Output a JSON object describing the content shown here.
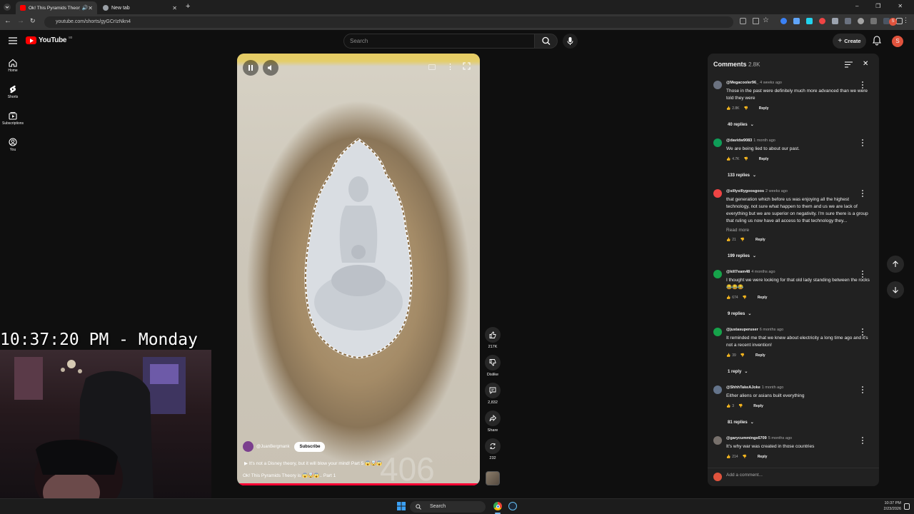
{
  "browser": {
    "tabs": [
      {
        "label": "Ok! This Pyramids Theory is",
        "active": true
      },
      {
        "label": "New tab",
        "active": false
      }
    ],
    "url": "youtube.com/shorts/gyGCrIzNkn4"
  },
  "header": {
    "logo_text": "YouTube",
    "logo_badge": "80",
    "search_placeholder": "Search",
    "create_label": "Create",
    "avatar_letter": "S"
  },
  "sidebar": {
    "items": [
      {
        "label": "Home",
        "icon": "home-icon"
      },
      {
        "label": "Shorts",
        "icon": "shorts-icon"
      },
      {
        "label": "Subscriptions",
        "icon": "subscriptions-icon"
      },
      {
        "label": "You",
        "icon": "you-icon"
      }
    ]
  },
  "video": {
    "channel": "@JuanBergmank",
    "subscribe_label": "Subscribe",
    "description": "It's not a Disney theory, but it will blow your mind! Part 5 😱🤯😱",
    "title": "Ok! This Pyramids Theory is 😱🤯😱.. Part 1",
    "progress": 1.0,
    "background_text": "406"
  },
  "actions": {
    "likes": "217K",
    "dislike_label": "Dislike",
    "comments": "2,832",
    "share_label": "Share",
    "remix": "232"
  },
  "comments": {
    "title": "Comments",
    "count": "2.8K",
    "add_placeholder": "Add a comment...",
    "items": [
      {
        "user": "@Megacooler96_",
        "time": "4 weeks ago",
        "text": "Those in the past were definitely much more advanced than we were told they were",
        "likes": "2.8K",
        "reply_label": "Reply",
        "replies": "40 replies",
        "avatar_color": "#6b7280"
      },
      {
        "user": "@davidw9083",
        "time": "1 month ago",
        "text": "We are being lied to about our past.",
        "likes": "4.7K",
        "reply_label": "Reply",
        "replies": "133 replies",
        "avatar_color": "#0f9d58"
      },
      {
        "user": "@sillysillygoosgoos",
        "time": "2 weeks ago",
        "text": "that generation which before us was enjoying all the highest technology, not sure what happen to them and us we are lack of everything but we are superior on negativity. I'm sure there is a group that ruling us now have all access to that technology they...",
        "read_more": "Read more",
        "likes": "21",
        "reply_label": "Reply",
        "replies": "199 replies",
        "avatar_color": "#ef4444"
      },
      {
        "user": "@kill7eam48",
        "time": "4 months ago",
        "text": "I thought we were looking for that old lady standing between the rocks 😂😂😂",
        "likes": "674",
        "reply_label": "Reply",
        "replies": "9 replies",
        "avatar_color": "#16a34a"
      },
      {
        "user": "@justasuperuser",
        "time": "6 months ago",
        "text": "It reminded me that we knew about electricity a long time ago and it's not a recent invention!",
        "likes": "39",
        "reply_label": "Reply",
        "replies": "1 reply",
        "avatar_color": "#16a34a"
      },
      {
        "user": "@ShhhTakeAJoke",
        "time": "1 month ago",
        "text": "Either aliens or asians built everything",
        "likes": "3",
        "reply_label": "Reply",
        "replies": "81 replies",
        "avatar_color": "#64748b"
      },
      {
        "user": "@garycummings6709",
        "time": "5 months ago",
        "text": "It's why war was created in those countries",
        "likes": "214",
        "reply_label": "Reply",
        "avatar_color": "#78716c"
      }
    ]
  },
  "overlay": {
    "clock": "10:37:20 PM - Monday"
  },
  "taskbar": {
    "search_label": "Search",
    "time": "10:37 PM",
    "date": "2/23/2026"
  }
}
